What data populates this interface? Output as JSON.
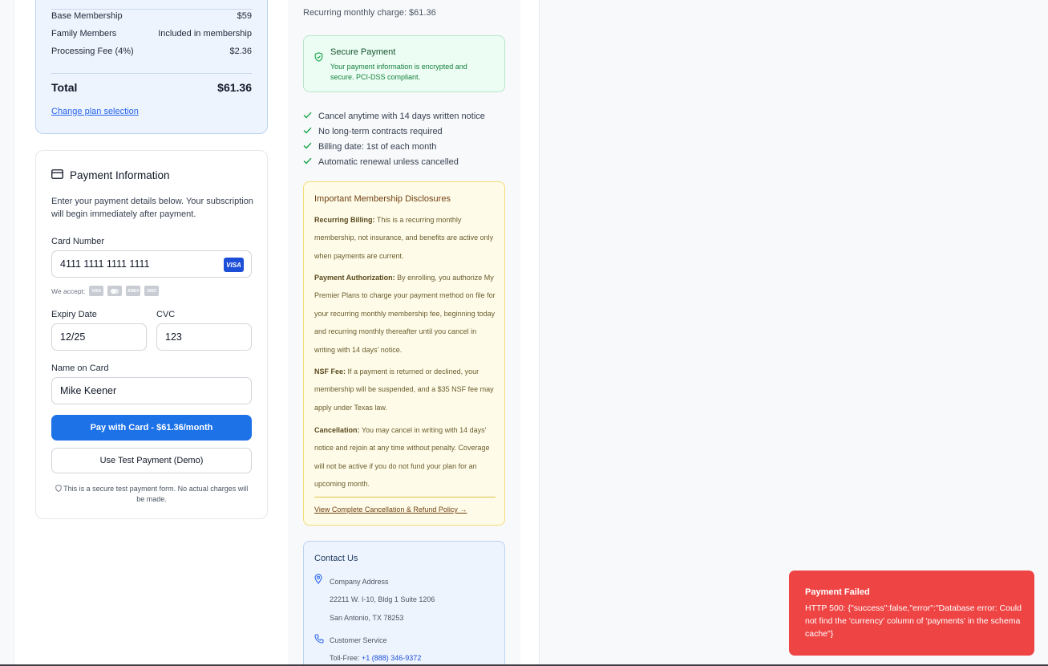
{
  "summary": {
    "rows": [
      {
        "label": "Base Membership",
        "value": "$59"
      },
      {
        "label": "Family Members",
        "value": "Included in membership"
      },
      {
        "label": "Processing Fee (4%)",
        "value": "$2.36"
      }
    ],
    "total_label": "Total",
    "total_value": "$61.36",
    "change_link": "Change plan selection"
  },
  "payment": {
    "title": "Payment Information",
    "description": "Enter your payment details below. Your subscription will begin immediately after payment.",
    "card_number_label": "Card Number",
    "card_number_value": "4111 1111 1111 1111",
    "card_brand": "VISA",
    "accept_label": "We accept:",
    "accepted_cards": [
      "VISA",
      "MC",
      "AMEX",
      "DISC"
    ],
    "expiry_label": "Expiry Date",
    "expiry_value": "12/25",
    "cvc_label": "CVC",
    "cvc_value": "123",
    "name_label": "Name on Card",
    "name_value": "Mike Keener",
    "pay_button": "Pay with Card - $61.36/month",
    "test_button": "Use Test Payment (Demo)",
    "secure_note": "This is a secure test payment form. No actual charges will be made."
  },
  "sidebar": {
    "recurring": "Recurring monthly charge: $61.36",
    "secure_title": "Secure Payment",
    "secure_text": "Your payment information is encrypted and secure. PCI-DSS compliant.",
    "checks": [
      "Cancel anytime with 14 days written notice",
      "No long-term contracts required",
      "Billing date: 1st of each month",
      "Automatic renewal unless cancelled"
    ],
    "disclosures": {
      "title": "Important Membership Disclosures",
      "items": [
        {
          "head": "Recurring Billing:",
          "text": " This is a recurring monthly membership, not insurance, and benefits are active only when payments are current."
        },
        {
          "head": "Payment Authorization:",
          "text": " By enrolling, you authorize My Premier Plans to charge your payment method on file for your recurring monthly membership fee, beginning today and recurring monthly thereafter until you cancel in writing with 14 days' notice."
        },
        {
          "head": "NSF Fee:",
          "text": " If a payment is returned or declined, your membership will be suspended, and a $35 NSF fee may apply under Texas law."
        },
        {
          "head": "Cancellation:",
          "text": " You may cancel in writing with 14 days' notice and rejoin at any time without penalty. Coverage will not be active if you do not fund your plan for an upcoming month."
        }
      ],
      "policy_link": "View Complete Cancellation & Refund Policy →"
    },
    "contact": {
      "title": "Contact Us",
      "address_label": "Company Address",
      "address_line1": "22211 W. I-10, Bldg 1 Suite 1206",
      "address_line2": "San Antonio, TX 78253",
      "service_label": "Customer Service",
      "tollfree_label": "Toll-Free: ",
      "tollfree_number": "+1 (888) 346-9372"
    }
  },
  "toast": {
    "title": "Payment Failed",
    "message": "HTTP 500: {\"success\":false,\"error\":\"Database error: Could not find the 'currency' column of 'payments' in the schema cache\"}"
  },
  "colors": {
    "primary": "#1d72e8",
    "error": "#ef4444",
    "success_bg": "#ecfdf3",
    "warning_bg": "#fefce8"
  }
}
